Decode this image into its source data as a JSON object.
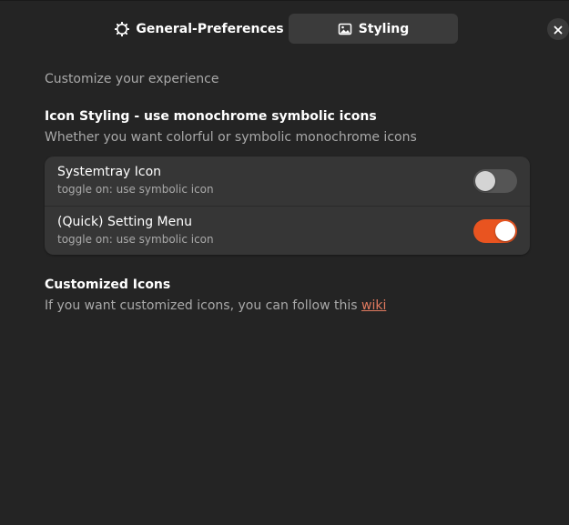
{
  "tabs": [
    {
      "label": "General-Preferences",
      "icon": "gear-icon",
      "active": false
    },
    {
      "label": "Styling",
      "icon": "image-icon",
      "active": true
    }
  ],
  "page": {
    "subtitle": "Customize your experience"
  },
  "icon_styling": {
    "title": "Icon Styling - use monochrome symbolic icons",
    "description": " Whether you want colorful or symbolic monochrome icons",
    "rows": [
      {
        "title": "Systemtray Icon",
        "subtitle": "toggle on: use symbolic icon",
        "enabled": false
      },
      {
        "title": "(Quick) Setting Menu",
        "subtitle": "toggle on: use symbolic icon",
        "enabled": true
      }
    ]
  },
  "customized_icons": {
    "title": "Customized Icons",
    "text": "If you want customized icons, you can follow this ",
    "link": "wiki"
  },
  "colors": {
    "accent": "#e95420",
    "link": "#e07a5f",
    "background": "#242424",
    "card": "#363636"
  }
}
